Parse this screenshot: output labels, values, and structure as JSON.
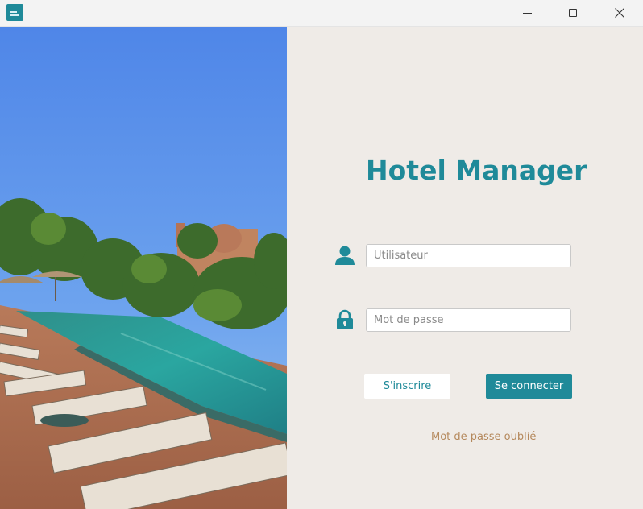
{
  "window": {
    "app_icon": "hotel-manager-logo-icon",
    "controls": [
      "minimize-icon",
      "maximize-icon",
      "close-icon"
    ]
  },
  "hero_image": {
    "description_icon": "resort-pool-photo"
  },
  "login": {
    "title": "Hotel Manager",
    "username_placeholder": "Utilisateur",
    "username_value": "",
    "password_placeholder": "Mot de passe",
    "password_value": "",
    "signup_label": "S'inscrire",
    "login_label": "Se connecter",
    "forgot_label": "Mot de passe oublié"
  },
  "colors": {
    "accent": "#1f8a99",
    "panel_background": "#efebe7",
    "link": "#b5895d"
  }
}
